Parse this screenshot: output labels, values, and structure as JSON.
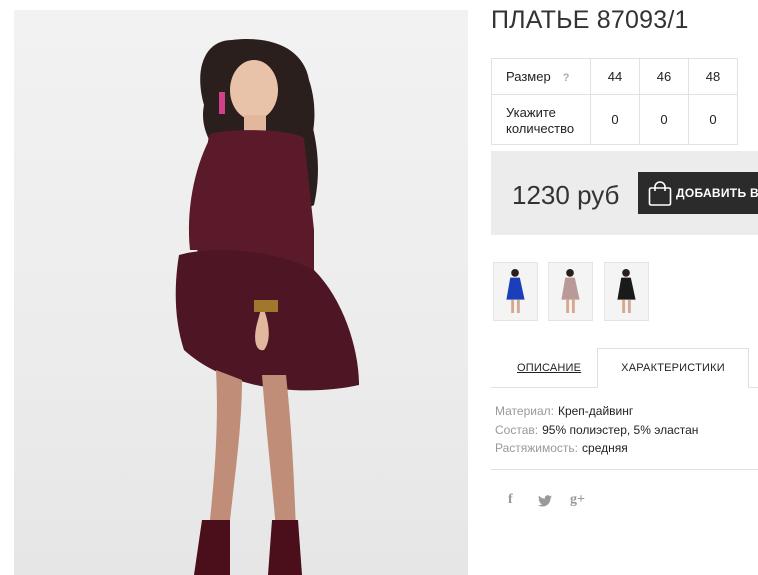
{
  "product": {
    "title": "ПЛАТЬЕ 87093/1",
    "main_image": {
      "description_icon": "product-photo",
      "dress_color": "#5a1a2a"
    }
  },
  "sizes": {
    "row1_label": "Размер",
    "help_icon": "?",
    "values": [
      "44",
      "46",
      "48"
    ],
    "row2_label_line1": "Укажите",
    "row2_label_line2": "количество",
    "quantities": [
      "0",
      "0",
      "0"
    ]
  },
  "buy": {
    "price": "1230 руб",
    "cart_label": "ДОБАВИТЬ В КОРЗИНУ",
    "cart_icon": "shopping-bag-icon"
  },
  "thumbnails": [
    {
      "name": "thumbnail-blue",
      "color": "#1b3fb8"
    },
    {
      "name": "thumbnail-beige",
      "color": "#b99a98"
    },
    {
      "name": "thumbnail-black",
      "color": "#1a1a1a"
    }
  ],
  "tabs": {
    "description": "ОПИСАНИЕ",
    "characteristics": "ХАРАКТЕРИСТИКИ"
  },
  "specs": [
    {
      "key": "Материал:",
      "value": "Креп-дайвинг"
    },
    {
      "key": "Состав:",
      "value": "95% полиэстер, 5% эластан"
    },
    {
      "key": "Растяжимость:",
      "value": "средняя"
    }
  ],
  "social": {
    "facebook": "f",
    "twitter": "twitter-icon",
    "googleplus": "g+"
  },
  "colors": {
    "cart_button": "#2b2b2b",
    "buybox_bg": "#ececec"
  }
}
